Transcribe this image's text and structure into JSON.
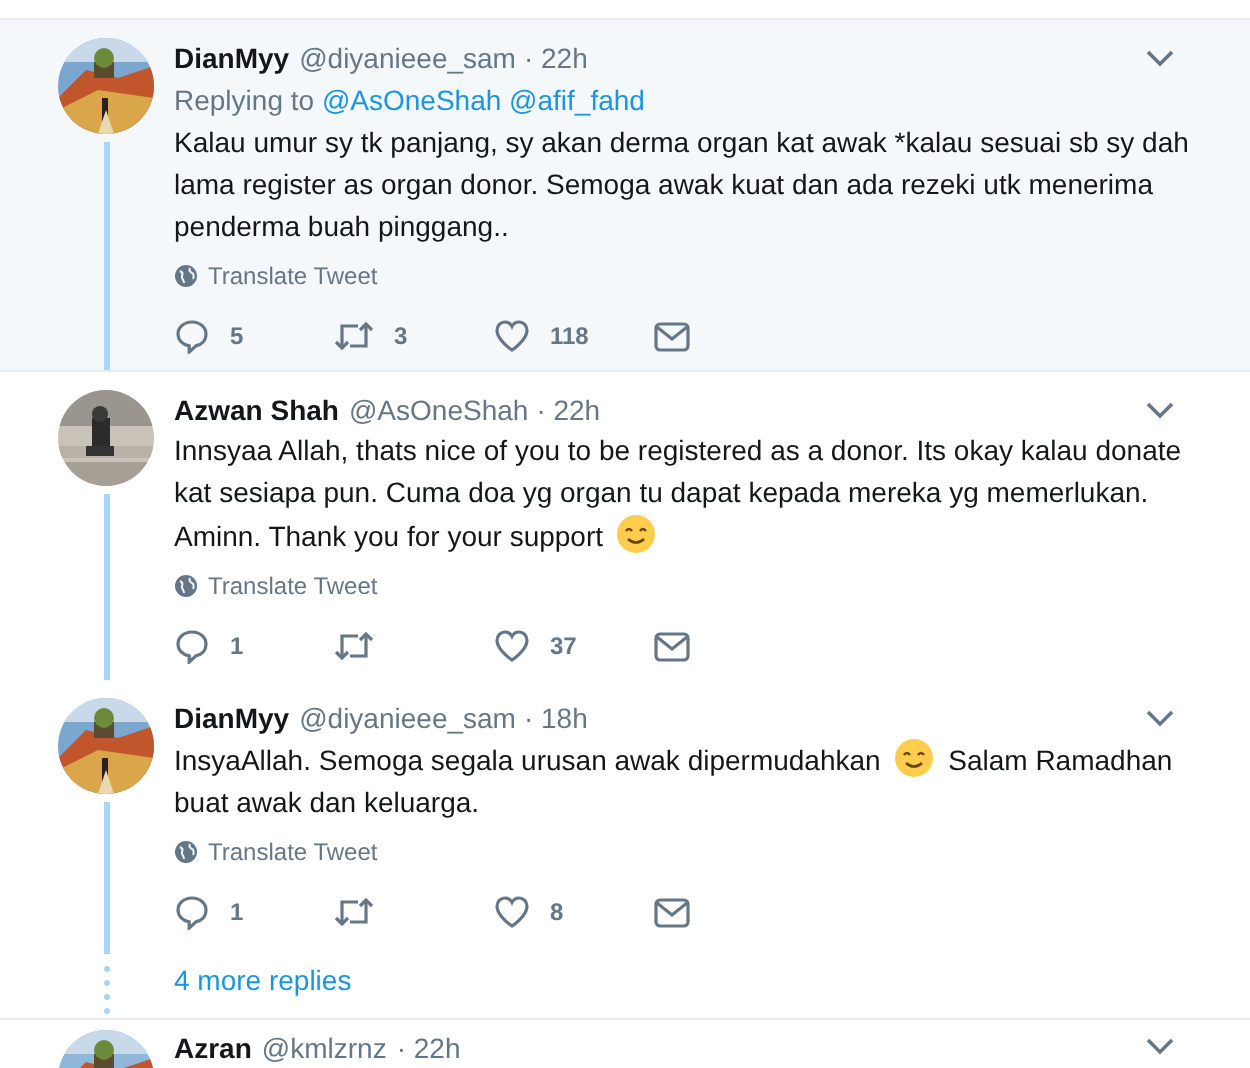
{
  "tweets": [
    {
      "name": "DianMyy",
      "handle": "@diyanieee_sam",
      "time": "· 22h",
      "highlighted": true,
      "reply_to": {
        "label": "Replying to",
        "mentions": [
          "@AsOneShah",
          "@afif_fahd"
        ]
      },
      "body": [
        {
          "kind": "text",
          "text": "Kalau umur sy tk panjang, sy akan derma organ kat awak *kalau sesuai sb sy dah lama register as organ donor. Semoga awak kuat dan ada rezeki utk menerima penderma buah pinggang.."
        }
      ],
      "translate": "Translate Tweet",
      "replies": "5",
      "retweets": "3",
      "likes": "118"
    },
    {
      "name": "Azwan Shah",
      "handle": "@AsOneShah",
      "time": "· 22h",
      "highlighted": false,
      "body": [
        {
          "kind": "text",
          "text": "Innsyaa Allah, thats nice of you to be registered as a donor. Its okay kalau donate kat sesiapa pun. Cuma doa yg organ tu dapat kepada mereka yg memerlukan."
        },
        {
          "kind": "text",
          "text": "Aminn. Thank you for your support"
        },
        {
          "kind": "emoji"
        }
      ],
      "translate": "Translate Tweet",
      "replies": "1",
      "likes": "37"
    },
    {
      "name": "DianMyy",
      "handle": "@diyanieee_sam",
      "time": "· 18h",
      "highlighted": false,
      "body": [
        {
          "kind": "text",
          "text": "InsyaAllah. Semoga segala urusan awak dipermudahkan"
        },
        {
          "kind": "emoji"
        },
        {
          "kind": "text",
          "text": "Salam Ramadhan"
        },
        {
          "kind": "text",
          "text": "buat awak dan keluarga."
        }
      ],
      "translate": "Translate Tweet",
      "replies": "1",
      "likes": "8"
    }
  ],
  "more_replies": "4 more replies",
  "next_tweet": {
    "name": "Azran",
    "handle": "@kmlzrnz",
    "time": "· 22h"
  }
}
